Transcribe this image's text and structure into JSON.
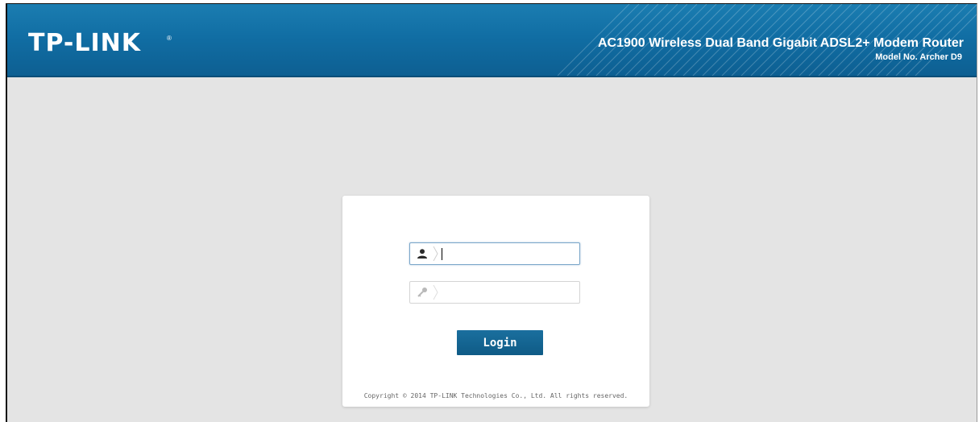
{
  "header": {
    "logo_text": "TP-LINK",
    "logo_registered": "®",
    "product_title": "AC1900 Wireless Dual Band Gigabit ADSL2+ Modem Router",
    "model_number": "Model No. Archer D9"
  },
  "login": {
    "username": {
      "icon": "user-icon",
      "value": "",
      "placeholder": ""
    },
    "password": {
      "icon": "key-icon",
      "value": "",
      "placeholder": ""
    },
    "button_label": "Login"
  },
  "footer": {
    "copyright": "Copyright © 2014 TP-LINK Technologies Co., Ltd. All rights reserved."
  },
  "colors": {
    "header_blue": "#116ea4",
    "button_blue": "#0f5b86",
    "background_gray": "#e4e4e4"
  }
}
